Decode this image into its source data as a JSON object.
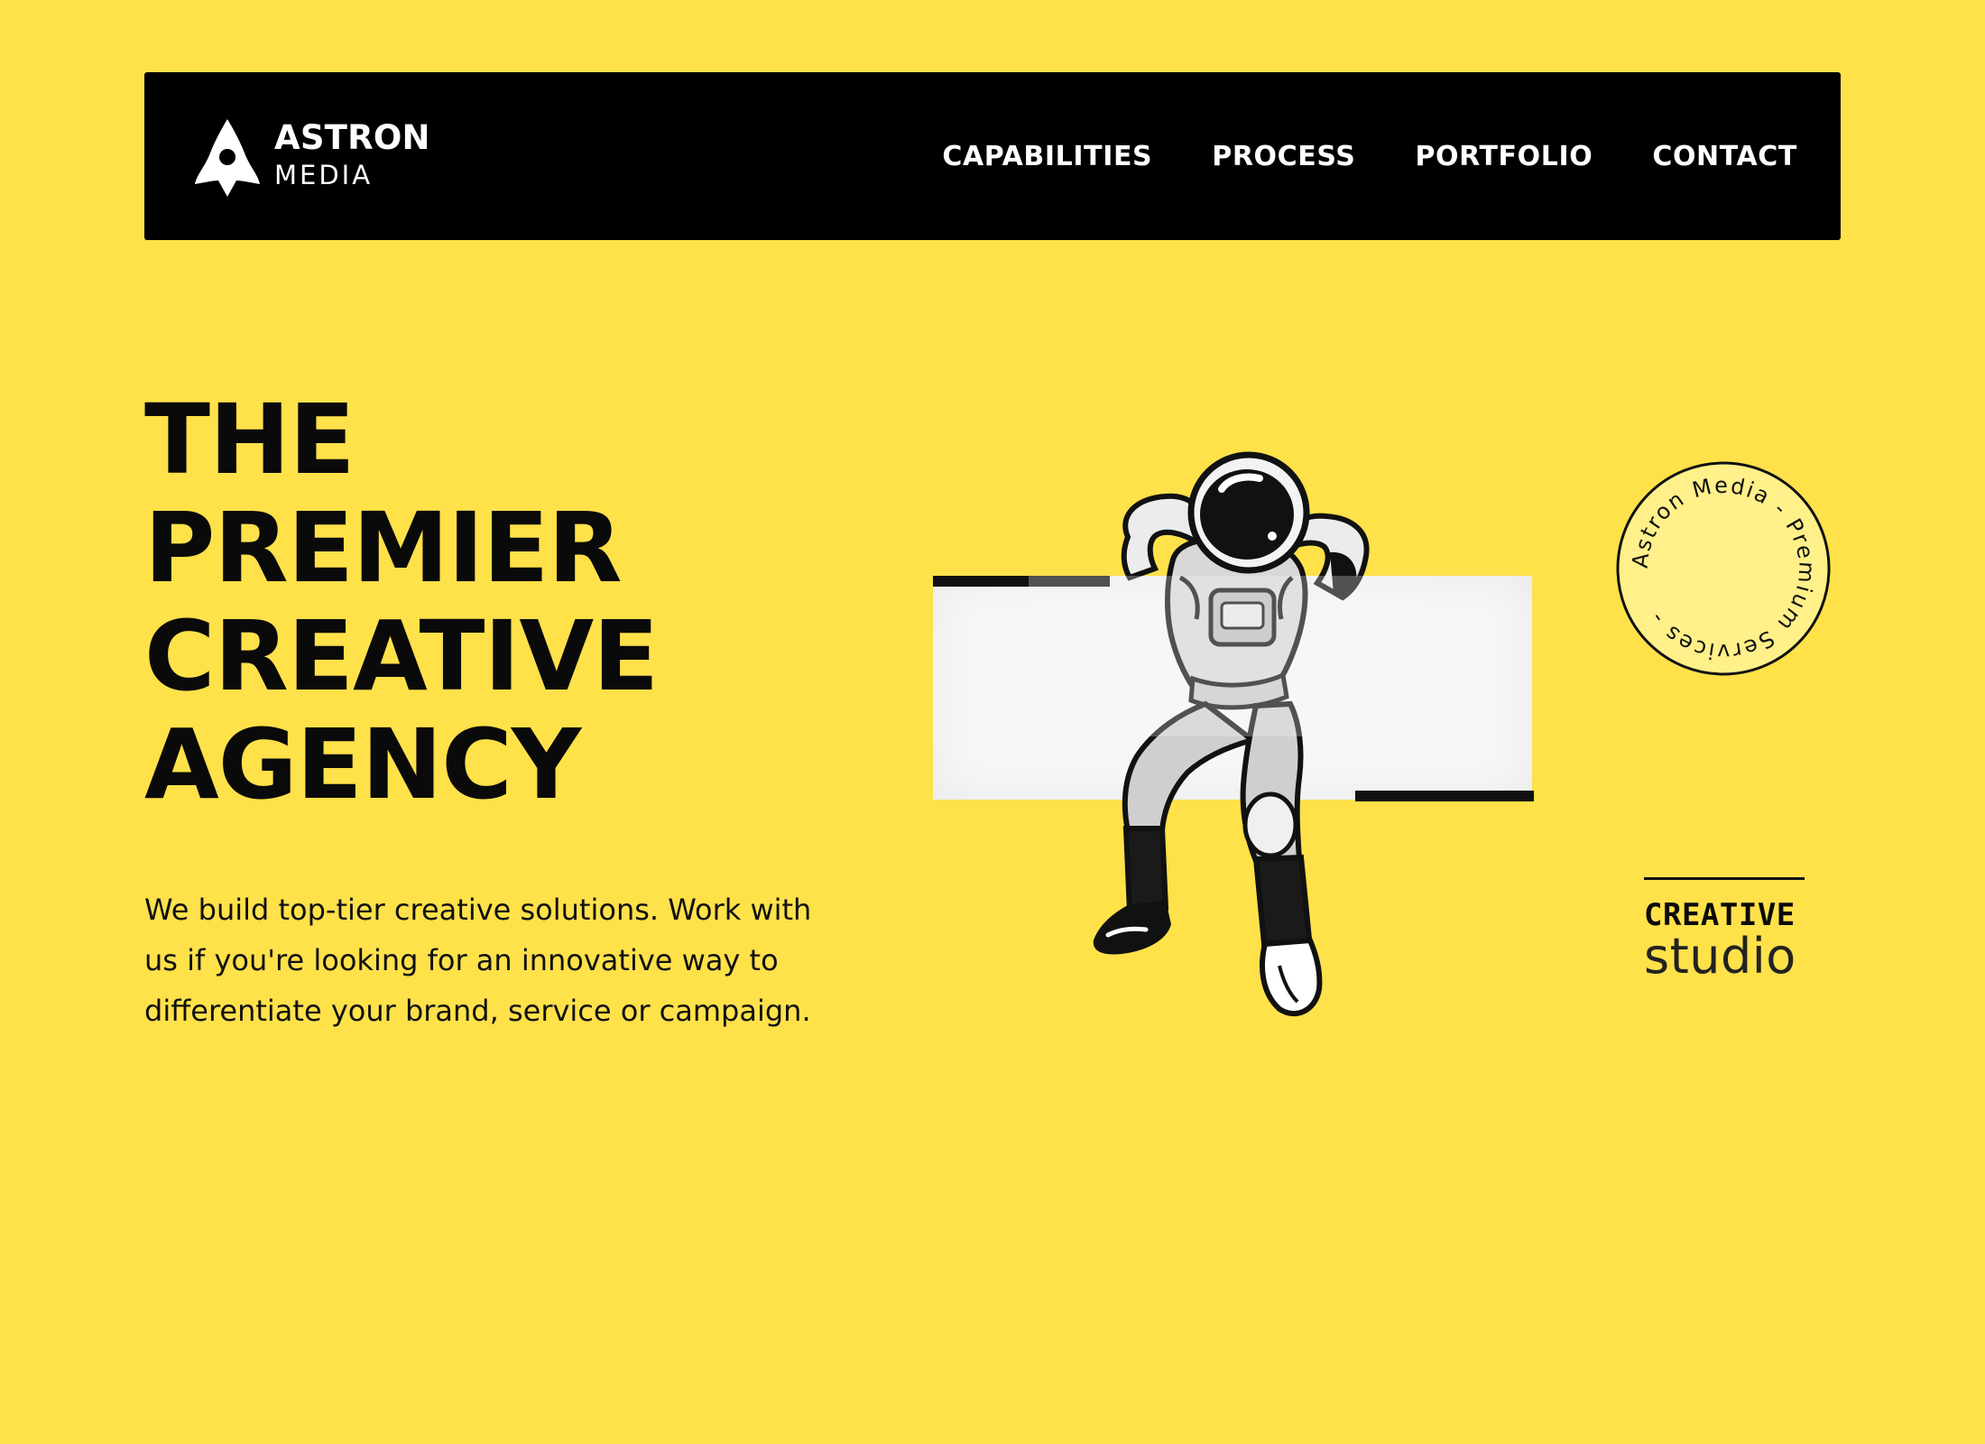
{
  "brand": {
    "name_primary": "ASTRON",
    "name_secondary": "MEDIA",
    "logo_icon": "rocket-icon"
  },
  "nav": {
    "items": [
      {
        "label": "CAPABILITIES"
      },
      {
        "label": "PROCESS"
      },
      {
        "label": "PORTFOLIO"
      },
      {
        "label": "CONTACT"
      }
    ]
  },
  "hero": {
    "headline_lines": [
      "THE",
      "PREMIER",
      "CREATIVE",
      "AGENCY"
    ],
    "description": "We build top-tier creative solutions. Work with us if you're looking for an innovative way to differentiate your brand, service or campaign.",
    "illustration": "astronaut-illustration"
  },
  "badge": {
    "circular_text": "Astron Media - Premium Services -"
  },
  "studio_tag": {
    "top": "CREATIVE",
    "bottom": "studio"
  },
  "colors": {
    "background": "#FFE14A",
    "nav_background": "#000000",
    "badge_fill": "#FFF08A",
    "text": "#0A0A0A",
    "panel": "#F7F7F7"
  }
}
